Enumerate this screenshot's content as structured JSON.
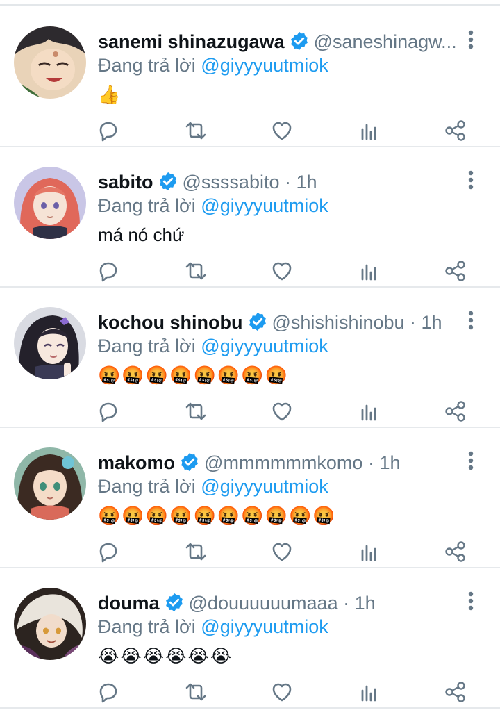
{
  "reply_prefix": "Đang trả lời",
  "colors": {
    "verified": "#1d9bf0",
    "mention": "#1d9bf0",
    "secondary": "#657786",
    "divider": "#e6e9ec"
  },
  "tweets": [
    {
      "name": "sanemi shinazugawa",
      "handle": "@saneshinagw...",
      "dot": "",
      "time": "",
      "reply_to": "@giyyyuutmiok",
      "text": "👍",
      "avatar_icon": "anime-avatar-sanemi"
    },
    {
      "name": "sabito",
      "handle": "@ssssabito",
      "dot": " · ",
      "time": "1h",
      "reply_to": "@giyyyuutmiok",
      "text": "má nó chứ",
      "avatar_icon": "anime-avatar-sabito"
    },
    {
      "name": "kochou shinobu",
      "handle": "@shishishinobu",
      "dot": " · ",
      "time": "1h",
      "reply_to": "@giyyyuutmiok",
      "text": "🤬🤬🤬🤬🤬🤬🤬🤬",
      "avatar_icon": "anime-avatar-shinobu"
    },
    {
      "name": "makomo",
      "handle": "@mmmmmmkomo",
      "dot": " · ",
      "time": "1h",
      "reply_to": "@giyyyuutmiok",
      "text": "🤬🤬🤬🤬🤬🤬🤬🤬🤬🤬",
      "avatar_icon": "anime-avatar-makomo"
    },
    {
      "name": "douma",
      "handle": "@douuuuuumaaa",
      "dot": " · ",
      "time": "1h",
      "reply_to": "@giyyyuutmiok",
      "text": "😭😭😭😭😭😭",
      "avatar_icon": "anime-avatar-douma"
    }
  ]
}
